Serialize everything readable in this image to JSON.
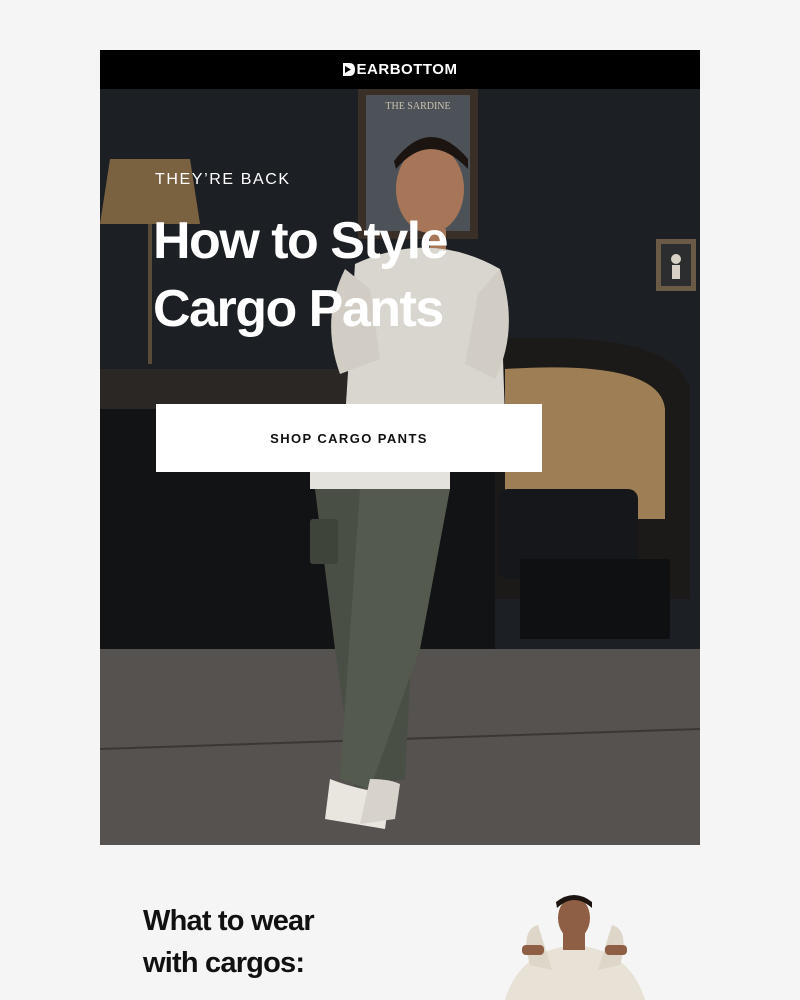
{
  "brand": {
    "logo_text": "EARBOTTOM"
  },
  "hero": {
    "eyebrow": "THEY’RE BACK",
    "headline_line1": "How to Style",
    "headline_line2": "Cargo Pants",
    "cta_label": "SHOP CARGO PANTS",
    "wall_sign": "THE SARDINE SAN PEDRO"
  },
  "section2": {
    "title_line1": "What to wear",
    "title_line2": "with cargos:"
  },
  "colors": {
    "header_bg": "#000000",
    "hero_text": "#ffffff",
    "cta_bg": "#ffffff",
    "cta_text": "#111111",
    "page_bg": "#f5f5f5"
  }
}
